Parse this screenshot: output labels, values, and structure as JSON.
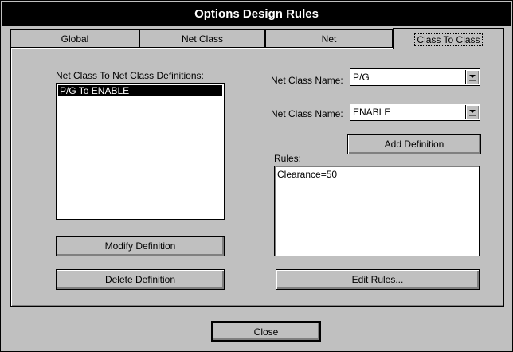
{
  "window": {
    "title": "Options Design Rules"
  },
  "tabs": [
    {
      "label": "Global",
      "active": false
    },
    {
      "label": "Net Class",
      "active": false
    },
    {
      "label": "Net",
      "active": false
    },
    {
      "label": "Class To Class",
      "active": true
    }
  ],
  "definitions": {
    "label": "Net Class To Net Class Definitions:",
    "items": [
      "P/G To ENABLE"
    ],
    "selected_index": 0
  },
  "net_class_1": {
    "label": "Net Class Name:",
    "value": "P/G"
  },
  "net_class_2": {
    "label": "Net Class Name:",
    "value": "ENABLE"
  },
  "buttons": {
    "add_definition": "Add Definition",
    "modify_definition": "Modify Definition",
    "delete_definition": "Delete Definition",
    "edit_rules": "Edit Rules...",
    "close": "Close"
  },
  "rules": {
    "label": "Rules:",
    "content": "Clearance=50"
  },
  "icons": {
    "dropdown": "chevron-down-icon"
  }
}
